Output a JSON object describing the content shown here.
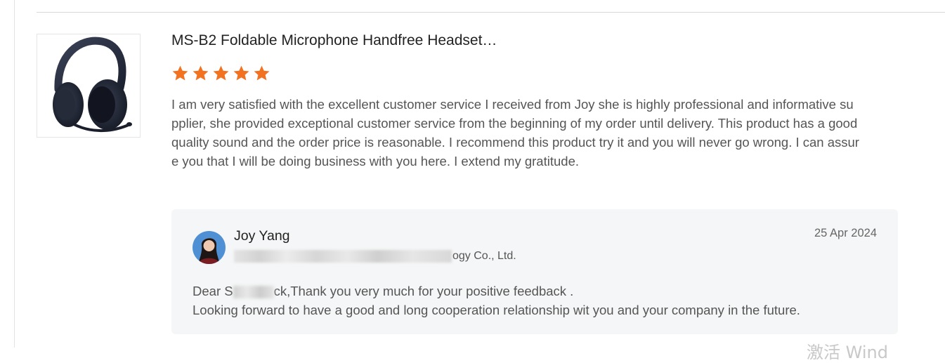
{
  "product": {
    "title": "MS-B2 Foldable Microphone Handfree Headset…",
    "thumbnail_icon": "headset-image",
    "rating": 5,
    "star_color": "#f27220"
  },
  "review": {
    "text": "I am very satisfied with the excellent customer service I received from Joy she is highly professional and informative supplier, she provided exceptional customer service from the beginning of my order until delivery. This product has a good quality sound and the order price is reasonable. I recommend this product try it and you will never go wrong. I can assure you that I will be doing business with you here. I extend my gratitude."
  },
  "reply": {
    "supplier_name": "Joy Yang",
    "company_suffix": "ogy Co., Ltd.",
    "date": "25 Apr 2024",
    "greeting_prefix": "Dear S",
    "line1_rest": "ck,Thank you very much for your positive feedback .",
    "line2": "Looking forward to have a good and long cooperation relationship wit you and your company in the future."
  },
  "watermark": {
    "text": "激活 Wind"
  }
}
